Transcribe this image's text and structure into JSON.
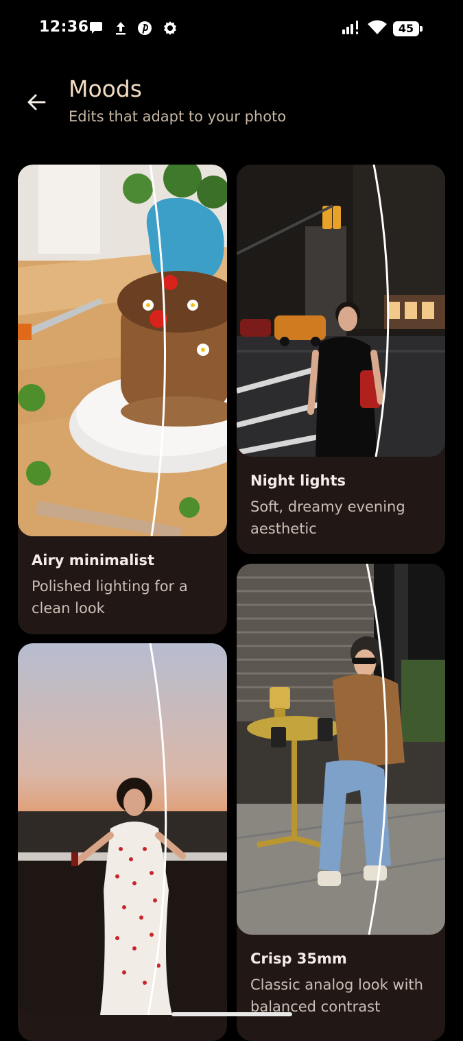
{
  "status_bar": {
    "time": "12:36",
    "left_icons": [
      "message-bubble-icon",
      "upload-icon",
      "pinterest-icon",
      "settings-gear-icon"
    ],
    "right_icons": [
      "signal-icon",
      "wifi-icon",
      "battery-icon"
    ],
    "battery_level": "45"
  },
  "header": {
    "back_icon": "arrow-left-icon",
    "title": "Moods",
    "subtitle": "Edits that adapt to your photo"
  },
  "moods": [
    {
      "title": "Airy minimalist",
      "description": "Polished lighting for a clean look",
      "image": "pancake-stack-on-plate"
    },
    {
      "title": "Night lights",
      "description": "Soft, dreamy evening aesthetic",
      "image": "woman-on-city-street-at-night"
    },
    {
      "title": "",
      "description": "",
      "image": "woman-in-polka-dot-dress-at-sunset"
    },
    {
      "title": "Crisp 35mm",
      "description": "Classic analog look with balanced contrast",
      "image": "woman-seated-at-cafe-table"
    }
  ],
  "colors": {
    "background": "#000000",
    "card": "#211714",
    "title_accent": "#f3dcc3",
    "subtitle": "#c9b8a6",
    "card_title": "#f4ece6",
    "card_desc": "#cbbfb6"
  }
}
